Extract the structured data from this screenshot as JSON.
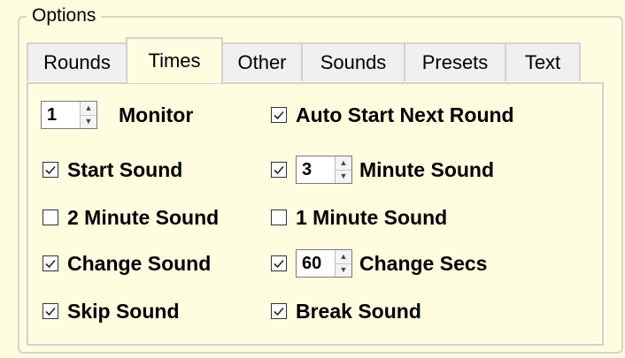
{
  "group": {
    "title": "Options"
  },
  "tabs": [
    "Rounds",
    "Times",
    "Other",
    "Sounds",
    "Presets",
    "Text"
  ],
  "active_tab": "Times",
  "times": {
    "monitor_spin": "1",
    "monitor_label": "Monitor",
    "auto_start_label": "Auto Start Next Round",
    "auto_start_checked": true,
    "start_sound_label": "Start Sound",
    "start_sound_checked": true,
    "minute_sound_spin": "3",
    "minute_sound_label": "Minute Sound",
    "minute_sound_checked": true,
    "two_min_label": "2 Minute Sound",
    "two_min_checked": false,
    "one_min_label": "1 Minute Sound",
    "one_min_checked": false,
    "change_sound_label": "Change Sound",
    "change_sound_checked": true,
    "change_secs_spin": "60",
    "change_secs_label": "Change Secs",
    "change_secs_checked": true,
    "skip_sound_label": "Skip Sound",
    "skip_sound_checked": true,
    "break_sound_label": "Break Sound",
    "break_sound_checked": true
  }
}
